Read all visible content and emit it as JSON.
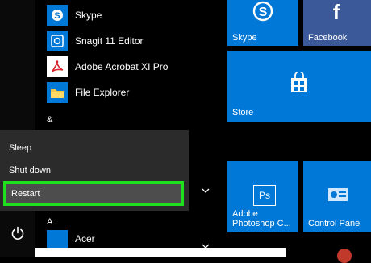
{
  "apps": [
    {
      "label": "Skype",
      "icon": "skype-icon"
    },
    {
      "label": "Snagit 11 Editor",
      "icon": "snagit-icon"
    },
    {
      "label": "Adobe Acrobat XI Pro",
      "icon": "acrobat-icon"
    },
    {
      "label": "File Explorer",
      "icon": "folder-icon"
    },
    {
      "label": "Acer",
      "icon": "acer-icon"
    }
  ],
  "groups": {
    "ampersand": "&",
    "a": "A"
  },
  "power_menu": {
    "sleep": "Sleep",
    "shut_down": "Shut down",
    "restart": "Restart"
  },
  "tiles": {
    "skype": "Skype",
    "facebook": "Facebook",
    "store": "Store",
    "photoshop_line1": "Adobe",
    "photoshop_line2": "Photoshop C...",
    "control_panel": "Control Panel",
    "ps_glyph": "Ps",
    "facebook_glyph": "f"
  },
  "colors": {
    "tile_blue": "#0078d7",
    "facebook_blue": "#3b5998",
    "highlight_green": "#1fe01f",
    "power_menu_bg": "#2b2b2b"
  }
}
